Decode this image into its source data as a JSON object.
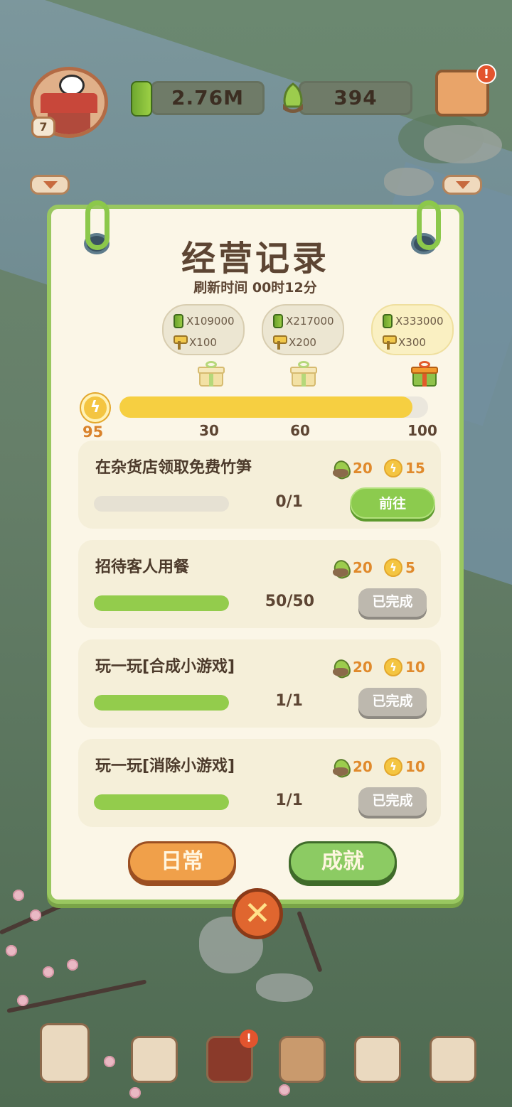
{
  "hud": {
    "level": "7",
    "bamboo_amount": "2.76M",
    "shoot_amount": "394",
    "shop_alert": "!"
  },
  "panel": {
    "title": "经营记录",
    "refresh": "刷新时间 00时12分",
    "rewards": [
      {
        "bamboo": "X109000",
        "roller": "X100"
      },
      {
        "bamboo": "X217000",
        "roller": "X200"
      },
      {
        "bamboo": "X333000",
        "roller": "X300"
      }
    ],
    "energy": {
      "value": "95",
      "max": 100,
      "current": 95
    },
    "ticks": [
      "30",
      "60",
      "100"
    ],
    "tasks": [
      {
        "name": "在杂货店领取免费竹笋",
        "shoot": "20",
        "energy": "15",
        "count": "0/1",
        "progress": 0,
        "button": "前往",
        "done": false
      },
      {
        "name": "招待客人用餐",
        "shoot": "20",
        "energy": "5",
        "count": "50/50",
        "progress": 1,
        "button": "已完成",
        "done": true
      },
      {
        "name": "玩一玩[合成小游戏]",
        "shoot": "20",
        "energy": "10",
        "count": "1/1",
        "progress": 1,
        "button": "已完成",
        "done": true
      },
      {
        "name": "玩一玩[消除小游戏]",
        "shoot": "20",
        "energy": "10",
        "count": "1/1",
        "progress": 1,
        "button": "已完成",
        "done": true
      }
    ],
    "tab_daily": "日常",
    "tab_achievement": "成就"
  },
  "close_glyph": "✕",
  "colors": {
    "accent_green": "#8ccb4e",
    "accent_orange": "#f0a04a",
    "energy_yellow": "#f6cf41"
  }
}
